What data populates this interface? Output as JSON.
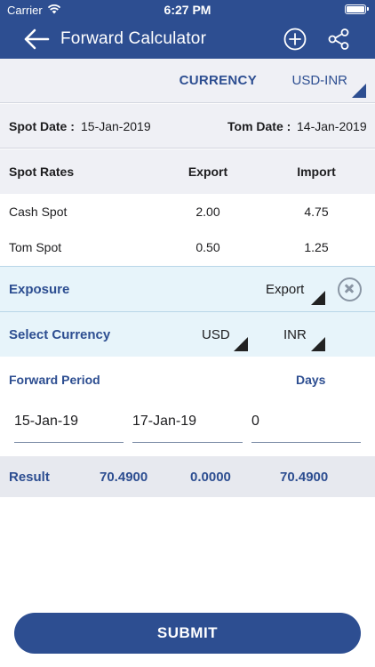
{
  "status_bar": {
    "carrier": "Carrier",
    "time": "6:27 PM",
    "icons": [
      "wifi-icon",
      "battery-icon"
    ]
  },
  "nav": {
    "title": "Forward Calculator",
    "icons": [
      "back-arrow-icon",
      "add-circle-icon",
      "share-icon"
    ]
  },
  "currency": {
    "label": "CURRENCY",
    "value": "USD-INR"
  },
  "dates": {
    "spot_label": "Spot Date :",
    "spot_value": "15-Jan-2019",
    "tom_label": "Tom Date :",
    "tom_value": "14-Jan-2019"
  },
  "rates": {
    "headers": [
      "Spot Rates",
      "Export",
      "Import"
    ],
    "rows": [
      [
        "Cash Spot",
        "2.00",
        "4.75"
      ],
      [
        "Tom Spot",
        "0.50",
        "1.25"
      ]
    ]
  },
  "exposure": {
    "label": "Exposure",
    "value": "Export"
  },
  "select_currency": {
    "label": "Select Currency",
    "from": "USD",
    "to": "INR"
  },
  "forward_period": {
    "label": "Forward Period",
    "days_label": "Days",
    "from_date": "15-Jan-19",
    "to_date": "17-Jan-19",
    "days": "0"
  },
  "result": {
    "label": "Result",
    "values": [
      "70.4900",
      "0.0000",
      "70.4900"
    ]
  },
  "submit_label": "SUBMIT",
  "colors": {
    "brand": "#2d4e91",
    "light_row": "#e7f4fa",
    "grey_row": "#eff0f5"
  }
}
